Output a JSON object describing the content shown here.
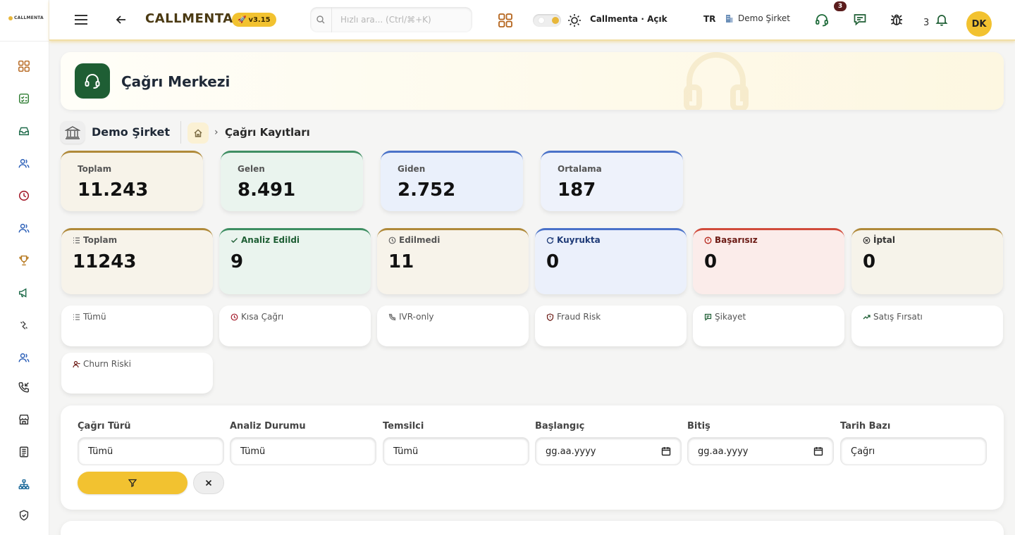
{
  "sidebar": {
    "brand": "CALLMENTA",
    "items": [
      {
        "name": "dashboard-icon",
        "color": "#b5651d"
      },
      {
        "name": "task-checklist-icon",
        "color": "#2f7d32"
      },
      {
        "name": "inbox-icon",
        "color": "#1e6b4a"
      },
      {
        "name": "users-icon",
        "color": "#2b5fb8"
      },
      {
        "name": "clock-icon",
        "color": "#a51d2d"
      },
      {
        "name": "team-icon",
        "color": "#2b5fb8"
      },
      {
        "name": "trophy-icon",
        "color": "#b7791f"
      },
      {
        "name": "megaphone-icon",
        "color": "#1e6b4a"
      },
      {
        "name": "integration-icon",
        "color": "#444444"
      },
      {
        "name": "contacts-icon",
        "color": "#2b5fb8"
      },
      {
        "name": "phone-incoming-icon",
        "color": "#333333"
      },
      {
        "name": "store-icon",
        "color": "#333333"
      },
      {
        "name": "report-icon",
        "color": "#333333"
      },
      {
        "name": "org-chart-icon",
        "color": "#1e6b9b"
      },
      {
        "name": "shield-check-icon",
        "color": "#333333"
      }
    ]
  },
  "header": {
    "app_title": "CALLMENTA",
    "version": "v3.15",
    "search_placeholder": "Hızlı ara... (Ctrl/⌘+K)",
    "theme_label": "Callmenta · Açık",
    "language": "TR",
    "company": "Demo Şirket",
    "support_badge": "3",
    "notification_count": "3",
    "avatar_initials": "DK"
  },
  "banner": {
    "title": "Çağrı Merkezi"
  },
  "breadcrumb": {
    "company": "Demo Şirket",
    "separator": "›",
    "current": "Çağrı Kayıtları"
  },
  "summary": [
    {
      "label": "Toplam",
      "value": "11.243",
      "accent": "#b08a3a",
      "bg": "#f7f3e9"
    },
    {
      "label": "Gelen",
      "value": "8.491",
      "accent": "#3f8f63",
      "bg": "#eaf4ee"
    },
    {
      "label": "Giden",
      "value": "2.752",
      "accent": "#4a72c9",
      "bg": "#eaf0fb"
    },
    {
      "label": "Ortalama",
      "value": "187",
      "accent": "#4a72c9",
      "bg": "#eef2fb"
    }
  ],
  "status": [
    {
      "label": "Toplam",
      "value": "11243",
      "accent": "#b08a3a",
      "bg": "#f7f3ea",
      "label_color": "#555555"
    },
    {
      "label": "Analiz Edildi",
      "value": "9",
      "accent": "#3f8f63",
      "bg": "#eaf4ee",
      "label_color": "#1e5e34"
    },
    {
      "label": "Edilmedi",
      "value": "11",
      "accent": "#b08a3a",
      "bg": "#f7f3ea",
      "label_color": "#555555"
    },
    {
      "label": "Kuyrukta",
      "value": "0",
      "accent": "#4a72c9",
      "bg": "#ebf0fb",
      "label_color": "#1f3b77"
    },
    {
      "label": "Başarısız",
      "value": "0",
      "accent": "#d14b3b",
      "bg": "#fbecea",
      "label_color": "#6b1a14"
    },
    {
      "label": "İptal",
      "value": "0",
      "accent": "#b08a3a",
      "bg": "#f6f3ea",
      "label_color": "#333333"
    }
  ],
  "chips": [
    {
      "label": "Tümü"
    },
    {
      "label": "Kısa Çağrı"
    },
    {
      "label": "IVR-only"
    },
    {
      "label": "Fraud Risk"
    },
    {
      "label": "Şikayet"
    },
    {
      "label": "Satış Fırsatı"
    },
    {
      "label": "Churn Riski"
    }
  ],
  "filters": [
    {
      "label": "Çağrı Türü",
      "value": "Tümü",
      "type": "select"
    },
    {
      "label": "Analiz Durumu",
      "value": "Tümü",
      "type": "select"
    },
    {
      "label": "Temsilci",
      "value": "Tümü",
      "type": "select"
    },
    {
      "label": "Başlangıç",
      "value": "gg.aa.yyyy",
      "type": "date"
    },
    {
      "label": "Bitiş",
      "value": "gg.aa.yyyy",
      "type": "date"
    },
    {
      "label": "Tarih Bazı",
      "value": "Çağrı",
      "type": "select"
    }
  ],
  "colors": {
    "accent": "#f2c230",
    "brand_green": "#1e5e34"
  }
}
